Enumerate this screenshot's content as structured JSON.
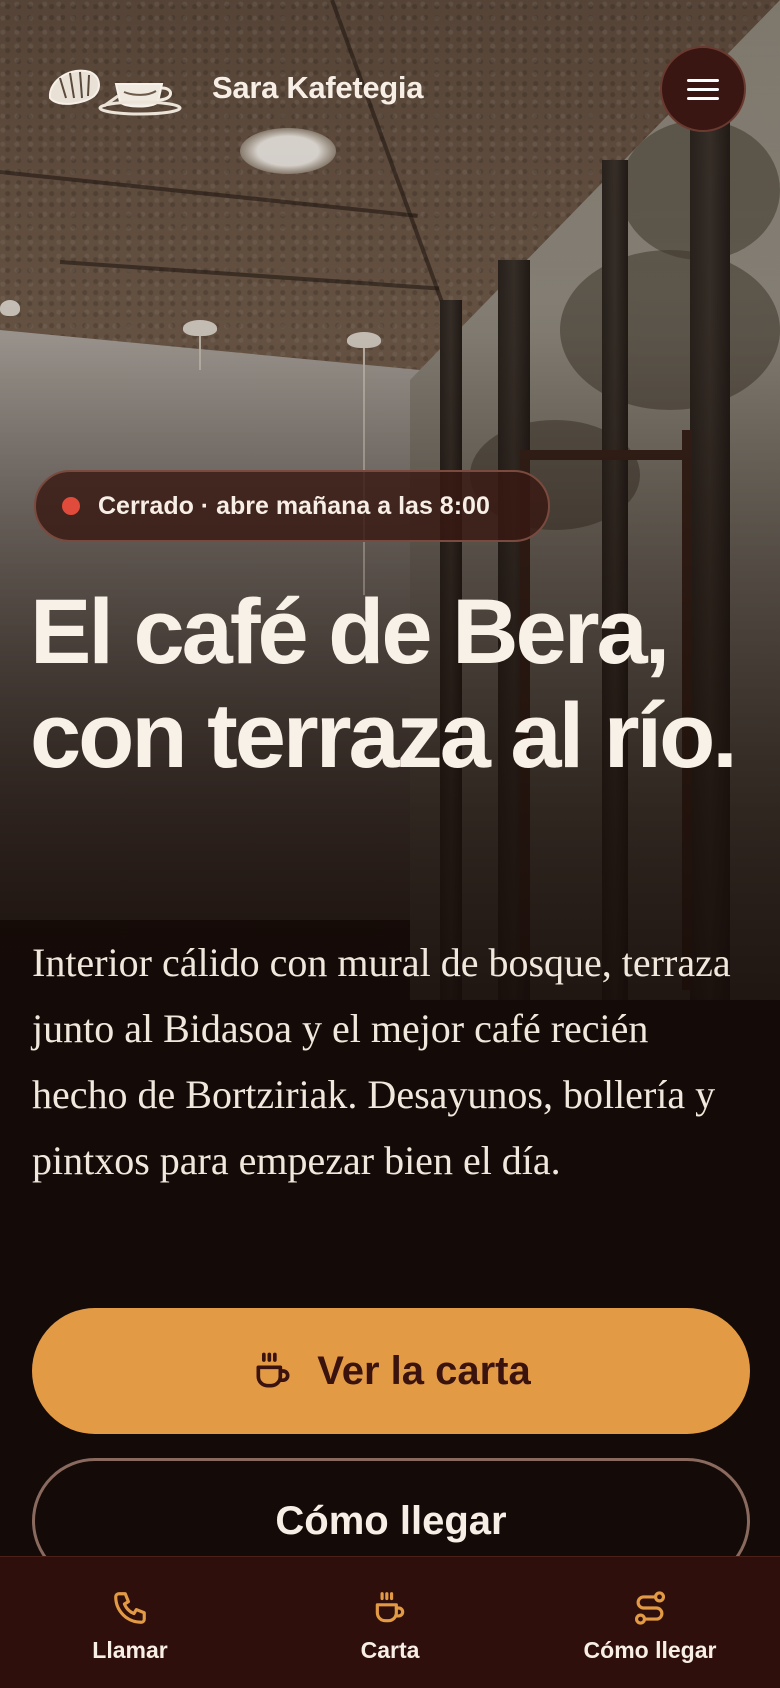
{
  "brand": {
    "name": "Sara Kafetegia"
  },
  "header": {
    "menu_icon": "hamburger-menu-icon"
  },
  "status": {
    "state": "closed",
    "dot_color": "#e04b3b",
    "text": "Cerrado · abre mañana a las 8:00"
  },
  "hero": {
    "headline": "El café de Bera, con terraza al río.",
    "lead": "Interior cálido con mural de bosque, terraza junto al Bidasoa y el mejor café recién hecho de Bortziriak. Desayunos, bollería y pintxos para empezar bien el día."
  },
  "cta": {
    "primary": {
      "label": "Ver la carta",
      "icon": "coffee-cup-icon"
    },
    "secondary": {
      "label": "Cómo llegar"
    }
  },
  "bottom_nav": {
    "items": [
      {
        "label": "Llamar",
        "icon": "phone-icon"
      },
      {
        "label": "Carta",
        "icon": "coffee-cup-icon"
      },
      {
        "label": "Cómo llegar",
        "icon": "route-icon"
      }
    ]
  },
  "colors": {
    "accent": "#e39a45",
    "nav_bg": "#2e0f0b",
    "icon": "#e39a45"
  }
}
